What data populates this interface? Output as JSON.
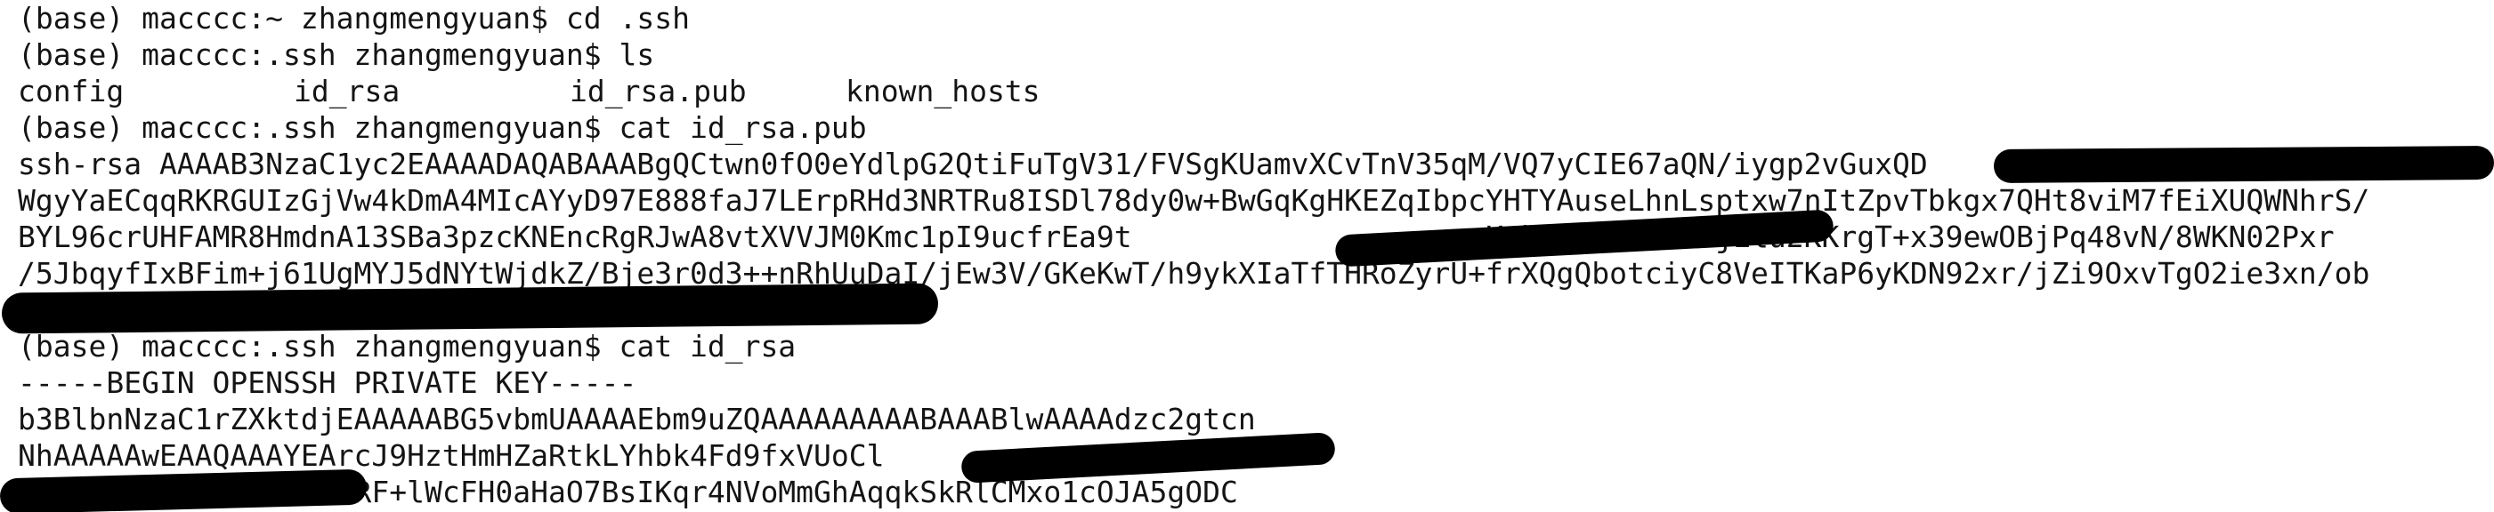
{
  "terminal": {
    "lines": [
      "(base) macccc:~ zhangmengyuan$ cd .ssh",
      "(base) macccc:.ssh zhangmengyuan$ ls",
      "",
      "(base) macccc:.ssh zhangmengyuan$ cat id_rsa.pub",
      "ssh-rsa AAAAB3NzaC1yc2EAAAADAQABAAABgQCtwn0fO0eYdlpG2QtiFuTgV31/FVSgKUamvXCvTnV35qM/VQ7yCIE67aQN/iygp2vGuxQD",
      "WgyYaECqqRKRGUIzGjVw4kDmA4MIcAYyD97E888faJ7LErpRHd3NRTRu8ISDl78dy0w+BwGqKgHKEZqIbpcYHTYAuseLhnLsptxw7nItZpvTbkgx7QHt8viM7fEiXUQWNhrS/",
      "BYL96crUHFAMR8HmdnA13SBa3pzcKNEncRgRJwA8vtXVVJM0Kmc1pI9ucfrEa9t                    K4hKxIJoL8V3fjElu2KKrgT+x39ewOBjPq48vN/8WKN02Pxr",
      "/5JbqyfIxBFim+j61UgMYJ5dNYtWjdkZ/Bje3r0d3++nRhUuDaI/jEw3V/GKeKwT/h9ykXIaTfTHRoZyrU+frXQgQbotciyC8VeITKaP6yKDN92xr/jZi9OxvTgO2ie3xn/ob",
      "",
      "(base) macccc:.ssh zhangmengyuan$ cat id_rsa",
      "-----BEGIN OPENSSH PRIVATE KEY-----",
      "b3BlbnNzaC1rZXktdjEAAAAABG5vbmUAAAAEbm9uZQAAAAAAAAABAAABlwAAAAdzc2gtcn",
      "NhAAAAAwEAAQAAAYEArcJ9HztHmHZaRtkLYhbk4Fd9fxVUoCl",
      "                 /iRF+lWcFH0aHaO7BsIKqr4NVoMmGhAqqkSkRlCMxo1cOJA5gODC"
    ],
    "ls_files": [
      "config",
      "id_rsa",
      "id_rsa.pub",
      "known_hosts"
    ]
  },
  "colors": {
    "background": "#ffffff",
    "text": "#141414",
    "redaction": "#000000"
  }
}
